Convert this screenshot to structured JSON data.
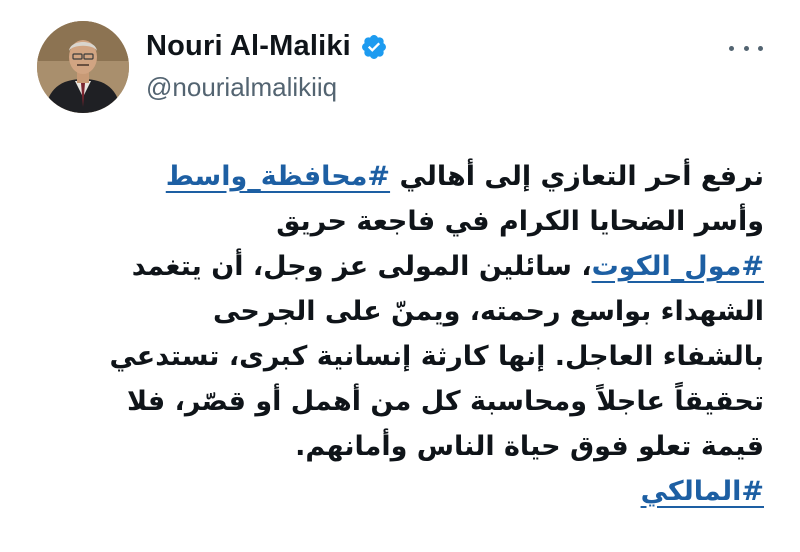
{
  "tweet": {
    "author": {
      "display_name": "Nouri Al-Maliki",
      "handle": "@nourialmalikiiq",
      "verified": true,
      "avatar_icon": "person-photo-icon"
    },
    "more_icon": "more-horizontal-icon",
    "body": {
      "lines": [
        {
          "before": "نرفع أحر التعازي إلى أهالي ",
          "hashtag": "#محافظة_واسط",
          "after": ""
        },
        {
          "before": "وأسر الضحايا الكرام في فاجعة حريق",
          "hashtag": "",
          "after": ""
        },
        {
          "before": "",
          "hashtag": "#مول_الكوت",
          "after": "، سائلين المولى عز وجل، أن يتغمد"
        },
        {
          "before": "الشهداء بواسع رحمته، ويمنّ على الجرحى",
          "hashtag": "",
          "after": ""
        },
        {
          "before": "بالشفاء العاجل. إنها كارثة إنسانية كبرى، تستدعي",
          "hashtag": "",
          "after": ""
        },
        {
          "before": "تحقيقاً عاجلاً ومحاسبة كل من أهمل أو قصّر، فلا",
          "hashtag": "",
          "after": ""
        },
        {
          "before": "قيمة تعلو فوق حياة الناس وأمانهم.",
          "hashtag": "",
          "after": ""
        },
        {
          "before": "",
          "hashtag": "#المالكي",
          "after": ""
        }
      ]
    },
    "colors": {
      "hashtag": "#1d5fa3",
      "text": "#0f1419",
      "secondary": "#536471",
      "verified_badge": "#1d9bf0"
    }
  }
}
